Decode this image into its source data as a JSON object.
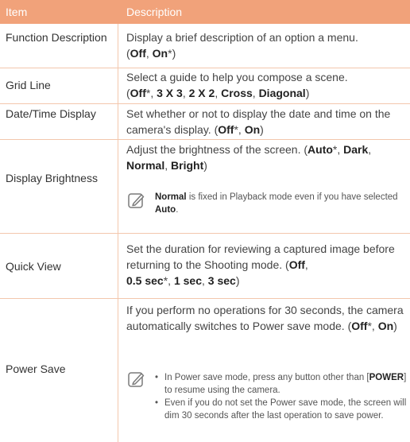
{
  "header": {
    "item": "Item",
    "description": "Description"
  },
  "rows": [
    {
      "item": "Function Description",
      "desc": "Display a brief description of an option a menu.",
      "opts": [
        {
          "t": "Off",
          "star": false
        },
        {
          "t": "On",
          "star": true
        }
      ]
    },
    {
      "item": "Grid Line",
      "desc": "Select a guide to help you compose a scene.",
      "opts": [
        {
          "t": "Off",
          "star": true
        },
        {
          "t": "3 X 3",
          "star": false
        },
        {
          "t": "2 X 2",
          "star": false
        },
        {
          "t": "Cross",
          "star": false
        },
        {
          "t": "Diagonal",
          "star": false
        }
      ]
    },
    {
      "item": "Date/Time Display",
      "desc": "Set whether or not to display the date and time on the camera's display.",
      "opts": [
        {
          "t": "Off",
          "star": true
        },
        {
          "t": "On",
          "star": false
        }
      ]
    },
    {
      "item": "Display Brightness",
      "desc": "Adjust the brightness of the screen.",
      "opts": [
        {
          "t": "Auto",
          "star": true
        },
        {
          "t": "Dark",
          "star": false
        },
        {
          "t": "Normal",
          "star": false
        },
        {
          "t": "Bright",
          "star": false
        }
      ],
      "note": {
        "bold1": "Normal",
        "text1": " is fixed in Playback mode even if you have selected ",
        "bold2": "Auto",
        "text2": "."
      }
    },
    {
      "item": "Quick View",
      "desc": "Set the duration for reviewing a captured image before returning to the Shooting mode.",
      "opts": [
        {
          "t": "Off",
          "star": false
        },
        {
          "t": "0.5 sec",
          "star": true
        },
        {
          "t": "1 sec",
          "star": false
        },
        {
          "t": "3 sec",
          "star": false
        }
      ]
    },
    {
      "item": "Power Save",
      "desc": "If you perform no operations for 30 seconds, the camera automatically switches to Power save mode.",
      "opts": [
        {
          "t": "Off",
          "star": true
        },
        {
          "t": "On",
          "star": false
        }
      ],
      "bullets": {
        "b1_pre": "In Power save mode, press any button other than [",
        "b1_bold": "POWER",
        "b1_post": "] to resume using the camera.",
        "b2": "Even if you do not set the Power save mode, the screen will dim 30 seconds after the last operation to save power."
      }
    }
  ],
  "colors": {
    "header_bg": "#f1a27a",
    "rule": "#f3c7ad",
    "text": "#333333"
  },
  "icons": {
    "note": "note-pencil-icon"
  }
}
